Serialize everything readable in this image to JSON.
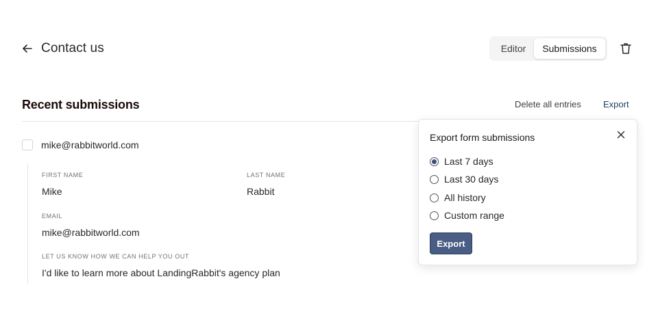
{
  "header": {
    "title": "Contact us",
    "tabs": [
      {
        "label": "Editor",
        "active": false
      },
      {
        "label": "Submissions",
        "active": true
      }
    ]
  },
  "section": {
    "title": "Recent submissions",
    "delete_all_label": "Delete all entries",
    "export_label": "Export"
  },
  "submission": {
    "email": "mike@rabbitworld.com",
    "fields": [
      {
        "label": "FIRST NAME",
        "value": "Mike"
      },
      {
        "label": "LAST NAME",
        "value": "Rabbit"
      },
      {
        "label": "EMAIL",
        "value": "mike@rabbitworld.com"
      },
      {
        "label": "LET US KNOW HOW WE CAN HELP YOU OUT",
        "value": "I'd like to learn more about LandingRabbit's agency plan"
      }
    ]
  },
  "export_popover": {
    "title": "Export form submissions",
    "options": [
      {
        "label": "Last 7 days",
        "selected": true
      },
      {
        "label": "Last 30 days",
        "selected": false
      },
      {
        "label": "All history",
        "selected": false
      },
      {
        "label": "Custom range",
        "selected": false
      }
    ],
    "button_label": "Export"
  },
  "icons": {
    "back": "arrow-left-icon",
    "delete": "trash-icon",
    "close": "close-icon"
  },
  "colors": {
    "primary_button": "#4a5d85",
    "radio_selected": "#3b4e73",
    "heading": "#1c0a0a"
  }
}
